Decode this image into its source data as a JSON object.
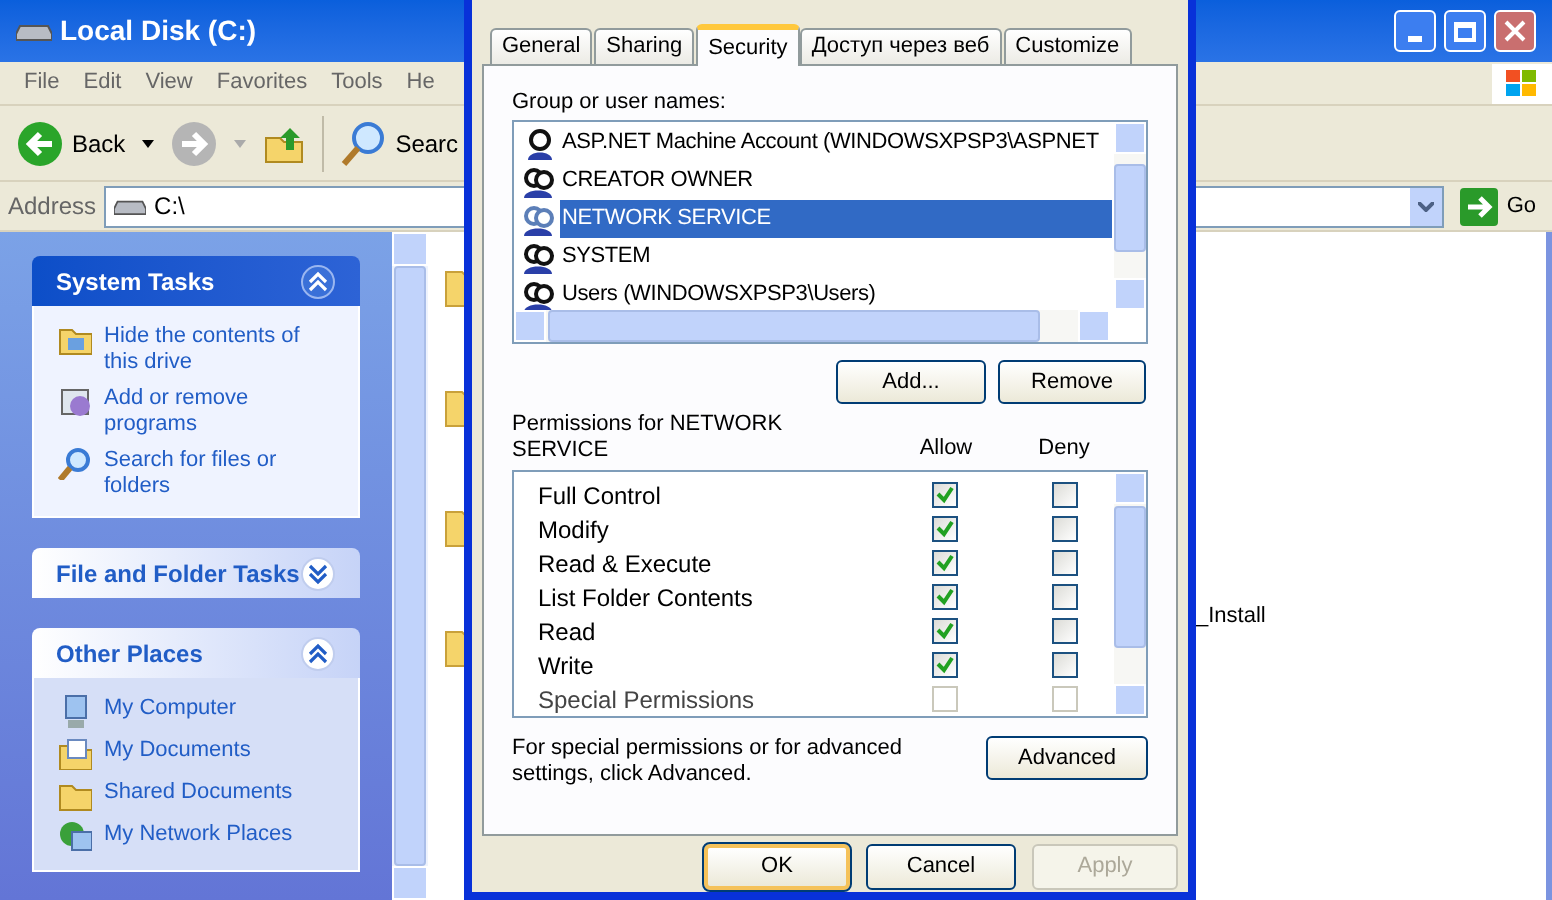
{
  "window": {
    "title": "Local Disk (C:)"
  },
  "menu": [
    "File",
    "Edit",
    "View",
    "Favorites",
    "Tools",
    "He"
  ],
  "toolbar": {
    "back": "Back",
    "search": "Searc"
  },
  "address": {
    "label": "Address",
    "value": "C:\\",
    "go": "Go"
  },
  "sidebar": [
    {
      "title": "System Tasks",
      "kind": "special",
      "expanded": true,
      "items": [
        "Hide the contents of this drive",
        "Add or remove programs",
        "Search for files or folders"
      ]
    },
    {
      "title": "File and Folder Tasks",
      "kind": "normal",
      "expanded": false
    },
    {
      "title": "Other Places",
      "kind": "normal",
      "expanded": true,
      "items": [
        "My Computer",
        "My Documents",
        "Shared Documents",
        "My Network Places"
      ]
    }
  ],
  "content": {
    "visible_label": "_Install"
  },
  "dialog": {
    "tabs": [
      {
        "label": "General",
        "selected": false
      },
      {
        "label": "Sharing",
        "selected": false
      },
      {
        "label": "Security",
        "selected": true
      },
      {
        "label": "Доступ через веб",
        "selected": false
      },
      {
        "label": "Customize",
        "selected": false
      }
    ],
    "group_label": "Group or user names:",
    "users": [
      {
        "name": "ASP.NET Machine Account (WINDOWSXPSP3\\ASPNET",
        "kind": "user",
        "selected": false
      },
      {
        "name": "CREATOR OWNER",
        "kind": "group",
        "selected": false
      },
      {
        "name": "NETWORK SERVICE",
        "kind": "group",
        "selected": true
      },
      {
        "name": "SYSTEM",
        "kind": "group",
        "selected": false
      },
      {
        "name": "Users (WINDOWSXPSP3\\Users)",
        "kind": "group",
        "selected": false
      }
    ],
    "add_button": "Add...",
    "remove_button": "Remove",
    "permissions_label": "Permissions for NETWORK SERVICE",
    "allow_header": "Allow",
    "deny_header": "Deny",
    "permissions": [
      {
        "name": "Full Control",
        "allow": true,
        "deny": false,
        "disabled": false
      },
      {
        "name": "Modify",
        "allow": true,
        "deny": false,
        "disabled": false
      },
      {
        "name": "Read & Execute",
        "allow": true,
        "deny": false,
        "disabled": false
      },
      {
        "name": "List Folder Contents",
        "allow": true,
        "deny": false,
        "disabled": false
      },
      {
        "name": "Read",
        "allow": true,
        "deny": false,
        "disabled": false
      },
      {
        "name": "Write",
        "allow": true,
        "deny": false,
        "disabled": false
      },
      {
        "name": "Special Permissions",
        "allow": false,
        "deny": false,
        "disabled": true
      }
    ],
    "advanced_note": "For special permissions or for advanced settings, click Advanced.",
    "advanced_button": "Advanced",
    "buttons": [
      {
        "label": "OK",
        "kind": "default",
        "disabled": false
      },
      {
        "label": "Cancel",
        "kind": "normal",
        "disabled": false
      },
      {
        "label": "Apply",
        "kind": "normal",
        "disabled": true
      }
    ]
  }
}
